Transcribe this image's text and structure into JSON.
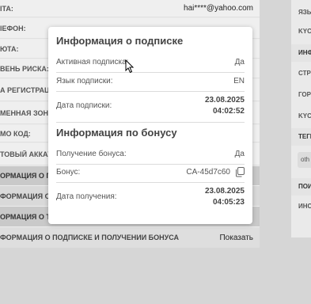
{
  "left_table": {
    "rows": [
      {
        "label": "ITA:"
      },
      {
        "label": "ІЕФОН:"
      },
      {
        "label": "ЮТА:"
      },
      {
        "label": "ВЕНЬ РИСКА:"
      },
      {
        "label": "А РЕГИСТРАЦ"
      },
      {
        "label": "МЕННАЯ ЗОН"
      },
      {
        "label": "МО КОД:"
      },
      {
        "label": "ТОВЫЙ АККАУ"
      }
    ],
    "email": "hai****@yahoo.com",
    "section_rows": [
      {
        "label": "ОРМАЦИЯ О П"
      },
      {
        "label": "ФОРМАЦИЯ О"
      },
      {
        "label": "ОРМАЦИЯ О Т"
      }
    ],
    "bottom_row": {
      "label": "ФОРМАЦИЯ О ПОДПИСКЕ И ПОЛУЧЕНИИ БОНУСА",
      "action": "Показать"
    }
  },
  "right_column": {
    "rows": [
      "ЯЗЫ",
      "KYC",
      "ИНФ",
      "СТР",
      "ГОР",
      "KYC",
      "ТЕГИ",
      "ПОИС",
      "ИНС"
    ],
    "tag": "oth"
  },
  "popup": {
    "subscription_title": "Информация о подписке",
    "active_label": "Активная подписка:",
    "active_value": "Да",
    "language_label": "Язык подписки:",
    "language_value": "EN",
    "date_label": "Дата подписки:",
    "date_value_1": "23.08.2025",
    "date_value_2": "04:02:52",
    "bonus_title": "Информация по бонусу",
    "bonus_received_label": "Получение бонуса:",
    "bonus_received_value": "Да",
    "bonus_label": "Бонус:",
    "bonus_value": "CA-45d7c60",
    "received_date_label": "Дата получения:",
    "received_date_value_1": "23.08.2025",
    "received_date_value_2": "04:05:23"
  }
}
